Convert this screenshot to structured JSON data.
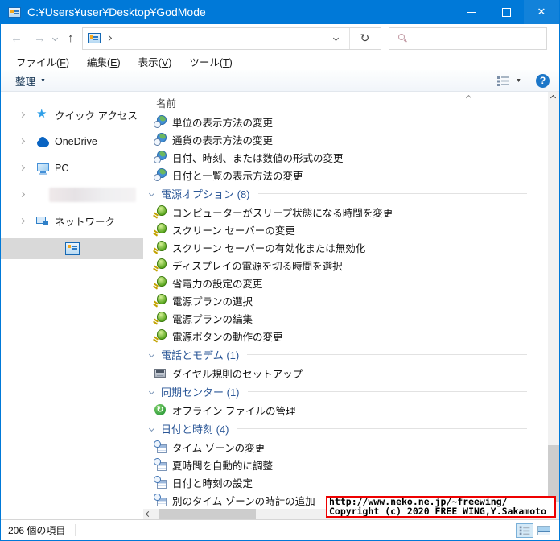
{
  "titlebar": {
    "title": "C:¥Users¥user¥Desktop¥GodMode"
  },
  "icons": {
    "back": "←",
    "forward": "→",
    "up": "↑",
    "refresh": "↻",
    "close": "✕",
    "help": "?",
    "organize_caret": "▼",
    "view_caret": "▼"
  },
  "address_bar": {
    "text": ""
  },
  "search": {
    "placeholder": "",
    "value": ""
  },
  "menu": {
    "items": [
      {
        "pre": "ファイル(",
        "key": "F",
        "post": ")"
      },
      {
        "pre": "編集(",
        "key": "E",
        "post": ")"
      },
      {
        "pre": "表示(",
        "key": "V",
        "post": ")"
      },
      {
        "pre": "ツール(",
        "key": "T",
        "post": ")"
      }
    ]
  },
  "toolbar": {
    "organize": "整理"
  },
  "sidebar": {
    "items": [
      {
        "label": "クイック アクセス",
        "icon": "quick-access-star",
        "expandable": true
      },
      {
        "label": "OneDrive",
        "icon": "onedrive-cloud",
        "expandable": true
      },
      {
        "label": "PC",
        "icon": "pc-monitor",
        "expandable": true
      },
      {
        "label": "",
        "icon": "redacted",
        "expandable": true,
        "redacted": true
      },
      {
        "label": "ネットワーク",
        "icon": "network-monitors",
        "expandable": true
      },
      {
        "label": "",
        "icon": "godmode",
        "selected": true
      }
    ]
  },
  "list": {
    "column_header": "名前",
    "groups": [
      {
        "header": null,
        "icon": "region",
        "items": [
          "単位の表示方法の変更",
          "通貨の表示方法の変更",
          "日付、時刻、または数値の形式の変更",
          "日付と一覧の表示方法の変更"
        ]
      },
      {
        "header": "電源オプション (8)",
        "icon": "power",
        "items": [
          "コンピューターがスリープ状態になる時間を変更",
          "スクリーン セーバーの変更",
          "スクリーン セーバーの有効化または無効化",
          "ディスプレイの電源を切る時間を選択",
          "省電力の設定の変更",
          "電源プランの選択",
          "電源プランの編集",
          "電源ボタンの動作の変更"
        ]
      },
      {
        "header": "電話とモデム (1)",
        "icon": "phone",
        "items": [
          "ダイヤル規則のセットアップ"
        ]
      },
      {
        "header": "同期センター (1)",
        "icon": "sync",
        "items": [
          "オフライン ファイルの管理"
        ]
      },
      {
        "header": "日付と時刻 (4)",
        "icon": "datetime",
        "items": [
          "タイム ゾーンの変更",
          "夏時間を自動的に調整",
          "日付と時刻の設定",
          "別のタイム ゾーンの時計の追加"
        ]
      }
    ]
  },
  "watermark": {
    "line1": "http://www.neko.ne.jp/~freewing/",
    "line2": "Copyright (c) 2020 FREE WING,Y.Sakamoto"
  },
  "statusbar": {
    "count": "206 個の項目"
  },
  "colors": {
    "titlebar": "#0079d8",
    "selection_inactive": "#d9d9d9",
    "group_header_text": "#2b5797",
    "watermark_border": "#ee0000",
    "help_blue": "#1b76c8"
  }
}
